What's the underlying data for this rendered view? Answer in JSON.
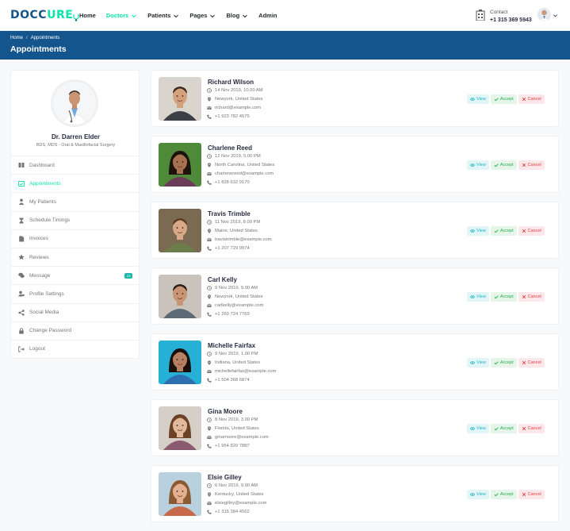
{
  "brand": {
    "name_part1": "DOCC",
    "name_part2": "URE"
  },
  "nav": [
    {
      "label": "Home",
      "caret": false,
      "active": false
    },
    {
      "label": "Doctors",
      "caret": true,
      "active": true
    },
    {
      "label": "Patients",
      "caret": true,
      "active": false
    },
    {
      "label": "Pages",
      "caret": true,
      "active": false
    },
    {
      "label": "Blog",
      "caret": true,
      "active": false
    },
    {
      "label": "Admin",
      "caret": false,
      "active": false
    }
  ],
  "contact": {
    "label": "Contact",
    "phone": "+1 315 369 5943"
  },
  "breadcrumb": {
    "home": "Home",
    "separator": "/",
    "current": "Appointments"
  },
  "page_title": "Appointments",
  "doctor": {
    "name": "Dr. Darren Elder",
    "specialty": "BDS, MDS - Oral & Maxillofacial Surgery"
  },
  "menu": [
    {
      "label": "Dashboard",
      "icon": "columns-icon",
      "active": false
    },
    {
      "label": "Appointments",
      "icon": "calendar-check-icon",
      "active": true
    },
    {
      "label": "My Patients",
      "icon": "user-injured-icon",
      "active": false
    },
    {
      "label": "Schedule Timings",
      "icon": "hourglass-icon",
      "active": false
    },
    {
      "label": "Invoices",
      "icon": "invoice-icon",
      "active": false
    },
    {
      "label": "Reviews",
      "icon": "star-icon",
      "active": false
    },
    {
      "label": "Message",
      "icon": "comments-icon",
      "active": false,
      "badge": "23"
    },
    {
      "label": "Profile Settings",
      "icon": "user-cog-icon",
      "active": false
    },
    {
      "label": "Social Media",
      "icon": "share-icon",
      "active": false
    },
    {
      "label": "Change Password",
      "icon": "lock-icon",
      "active": false
    },
    {
      "label": "Logout",
      "icon": "sign-out-icon",
      "active": false
    }
  ],
  "actions": {
    "view": "View",
    "accept": "Accept",
    "cancel": "Cancel"
  },
  "appointments": [
    {
      "name": "Richard Wilson",
      "datetime": "14 Nov 2019, 10.00 AM",
      "location": "Newyork, United States",
      "email": "richard@example.com",
      "phone": "+1 923 782 4575"
    },
    {
      "name": "Charlene Reed",
      "datetime": "12 Nov 2019, 5.00 PM",
      "location": "North Carolina, United States",
      "email": "charlenereed@example.com",
      "phone": "+1 828 632 9170"
    },
    {
      "name": "Travis Trimble",
      "datetime": "11 Nov 2019, 8.00 PM",
      "location": "Maine, United States",
      "email": "travistrimble@example.com",
      "phone": "+1 207 729 9974"
    },
    {
      "name": "Carl Kelly",
      "datetime": "9 Nov 2019, 9.00 AM",
      "location": "Newyork, United States",
      "email": "carlkelly@example.com",
      "phone": "+1 260 724 7769"
    },
    {
      "name": "Michelle Fairfax",
      "datetime": "9 Nov 2019, 1.00 PM",
      "location": "Indiana, United States",
      "email": "michellefairfax@example.com",
      "phone": "+1 504 368 6874"
    },
    {
      "name": "Gina Moore",
      "datetime": "8 Nov 2019, 3.00 PM",
      "location": "Florida, United States",
      "email": "ginamoore@example.com",
      "phone": "+1 954 820 7887"
    },
    {
      "name": "Elsie Gilley",
      "datetime": "6 Nov 2019, 9.00 AM",
      "location": "Kentucky, United States",
      "email": "elsiegilley@example.com",
      "phone": "+1 315 384 4562"
    }
  ],
  "colors": {
    "primary": "#15558d",
    "accent": "#09e5ab",
    "accept": "#26af48",
    "cancel": "#e63c3c",
    "view": "#19b5c4"
  }
}
